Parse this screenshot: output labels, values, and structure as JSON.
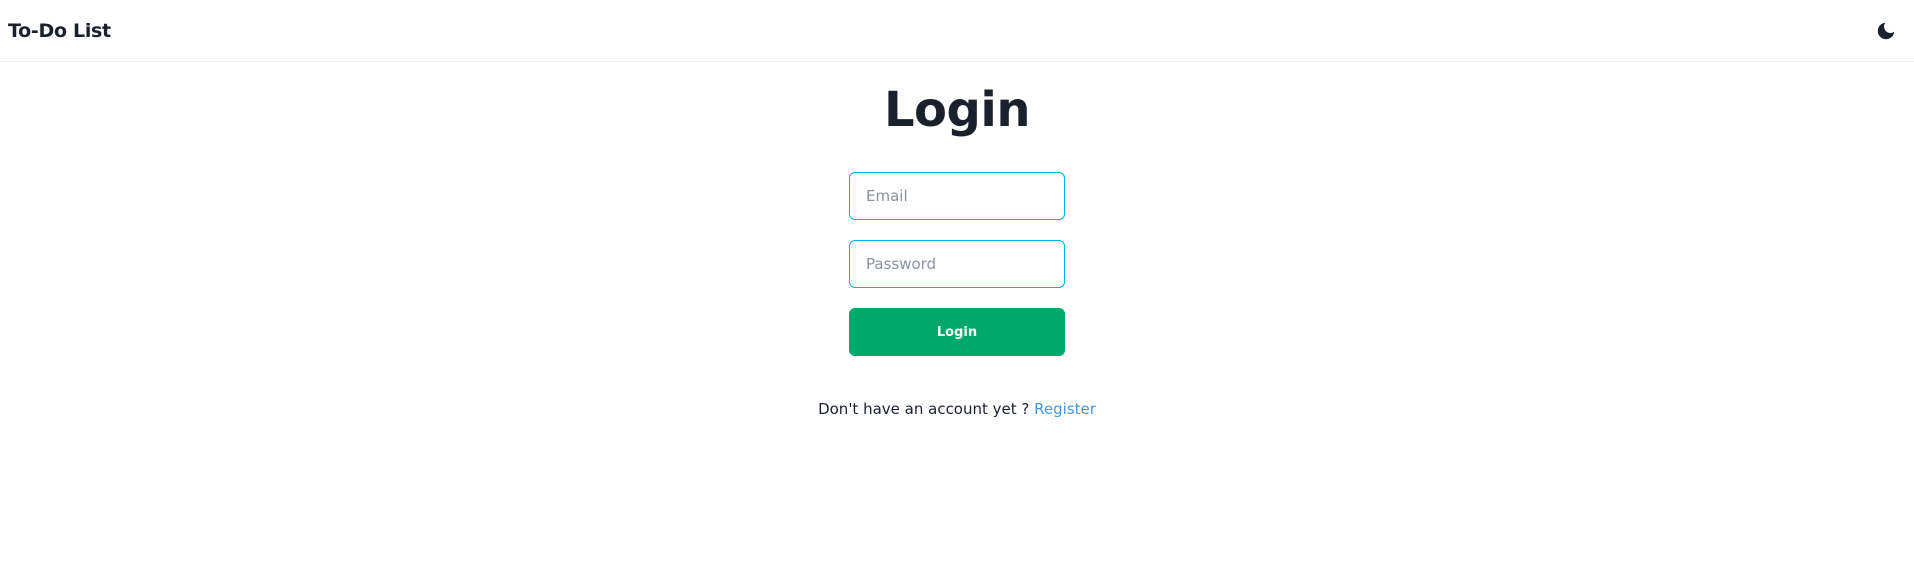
{
  "header": {
    "app_title": "To-Do List",
    "theme_toggle_icon": "moon-icon"
  },
  "login": {
    "title": "Login",
    "email_placeholder": "Email",
    "email_value": "",
    "password_placeholder": "Password",
    "password_value": "",
    "submit_label": "Login",
    "register_prompt": "Don't have an account yet ?",
    "register_link": "Register"
  },
  "colors": {
    "input_border": "#00b5d8",
    "button_bg": "#00a86b",
    "link": "#4299e1",
    "text": "#1a202c"
  }
}
